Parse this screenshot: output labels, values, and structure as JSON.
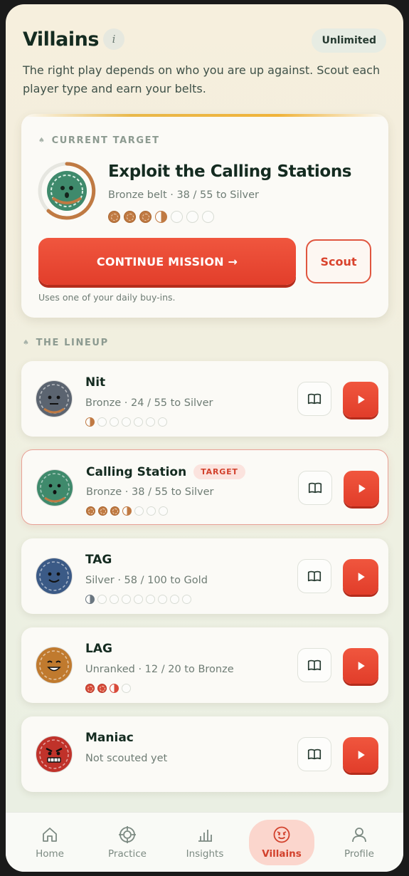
{
  "header": {
    "title": "Villains",
    "info_icon": "i",
    "plan_badge": "Unlimited",
    "subtitle": "The right play depends on who you are up against. Scout each player type and earn your belts."
  },
  "current_target": {
    "section_label": "CURRENT TARGET",
    "title": "Exploit the Calling Stations",
    "subtitle": "Bronze belt · 38 / 55 to Silver",
    "progress_pips": [
      "filled",
      "filled",
      "filled",
      "half",
      "empty",
      "empty",
      "empty"
    ],
    "continue_label": "CONTINUE MISSION →",
    "scout_label": "Scout",
    "note": "Uses one of your daily buy-ins.",
    "avatar_color": "#3f8a6c"
  },
  "lineup": {
    "section_label": "THE LINEUP",
    "rows": [
      {
        "name": "Nit",
        "tag": "",
        "subtitle": "Bronze · 24 / 55 to Silver",
        "avatar_color": "#5b6470",
        "face": "neutral",
        "pips": [
          "half",
          "empty",
          "empty",
          "empty",
          "empty",
          "empty",
          "empty"
        ],
        "pip_style": "bronze"
      },
      {
        "name": "Calling Station",
        "tag": "TARGET",
        "subtitle": "Bronze · 38 / 55 to Silver",
        "avatar_color": "#3f8a6c",
        "face": "surprised",
        "pips": [
          "filled",
          "filled",
          "filled",
          "half",
          "empty",
          "empty",
          "empty"
        ],
        "pip_style": "bronze"
      },
      {
        "name": "TAG",
        "tag": "",
        "subtitle": "Silver · 58 / 100 to Gold",
        "avatar_color": "#3b5a86",
        "face": "smile",
        "pips": [
          "half",
          "empty",
          "empty",
          "empty",
          "empty",
          "empty",
          "empty",
          "empty",
          "empty"
        ],
        "pip_style": "silver"
      },
      {
        "name": "LAG",
        "tag": "",
        "subtitle": "Unranked · 12 / 20 to Bronze",
        "avatar_color": "#c07a2e",
        "face": "grin",
        "pips": [
          "filled",
          "filled",
          "half",
          "empty"
        ],
        "pip_style": "red"
      },
      {
        "name": "Maniac",
        "tag": "",
        "subtitle": "Not scouted yet",
        "avatar_color": "#c0322a",
        "face": "angry",
        "pips": [],
        "pip_style": "red"
      }
    ]
  },
  "tabbar": {
    "items": [
      {
        "label": "Home",
        "icon": "home-icon"
      },
      {
        "label": "Practice",
        "icon": "target-icon"
      },
      {
        "label": "Insights",
        "icon": "bar-chart-icon"
      },
      {
        "label": "Villains",
        "icon": "villain-face-icon",
        "active": true
      },
      {
        "label": "Profile",
        "icon": "person-icon"
      }
    ]
  },
  "colors": {
    "accent": "#e23e2b",
    "bronze": "#c07a43",
    "ink": "#142b20"
  }
}
